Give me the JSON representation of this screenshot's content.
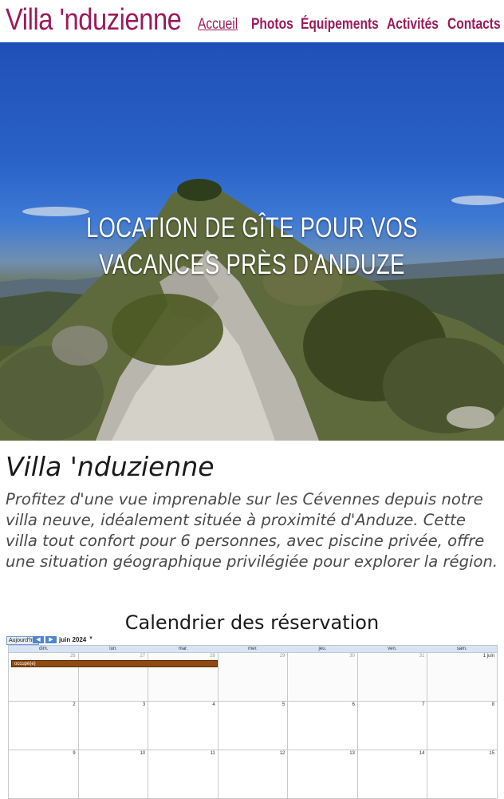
{
  "site": {
    "logo": "Villa 'nduzienne",
    "nav": [
      "Accueil",
      "Photos",
      "Équipements",
      "Activités",
      "Contacts"
    ]
  },
  "hero": {
    "title_line1": "LOCATION DE GÎTE POUR VOS",
    "title_line2": "VACANCES PRÈS D'ANDUZE"
  },
  "intro": {
    "title": "Villa 'nduzienne",
    "text": "Profitez d'une vue imprenable sur les Cévennes depuis notre villa neuve, idéalement située à proximité d'Anduze. Cette villa tout confort pour 6 personnes, avec piscine privée, offre une situation géographique privilégiée pour explorer la région."
  },
  "calendar": {
    "heading": "Calendrier des réservation",
    "today_label": "Aujourd'hui",
    "prev_icon": "chevron-left-icon",
    "next_icon": "chevron-right-icon",
    "month_label": "juin 2024",
    "weekdays": [
      "dim.",
      "lun.",
      "mar.",
      "mer.",
      "jeu.",
      "ven.",
      "sam."
    ],
    "weeks": [
      [
        "26",
        "27",
        "28",
        "29",
        "30",
        "31",
        "1 juin"
      ],
      [
        "2",
        "3",
        "4",
        "5",
        "6",
        "7",
        "8"
      ],
      [
        "9",
        "10",
        "11",
        "12",
        "13",
        "14",
        "15"
      ]
    ],
    "event_label": "occupé(e)",
    "event_color": "#8d4a12",
    "accent_color": "#9b1b5a"
  }
}
